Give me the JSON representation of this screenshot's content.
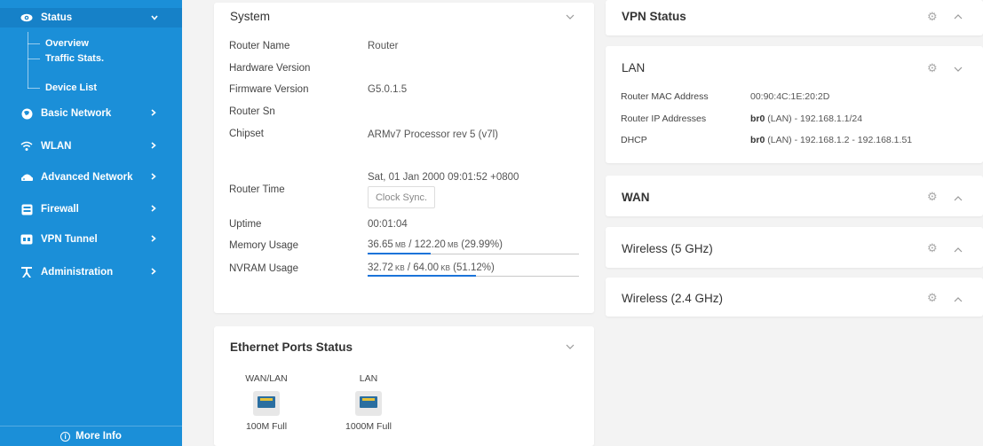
{
  "sidebar": {
    "items": [
      {
        "label": "Status",
        "icon": "eye-icon"
      },
      {
        "label": "Basic Network",
        "icon": "globe-icon"
      },
      {
        "label": "WLAN",
        "icon": "wifi-icon"
      },
      {
        "label": "Advanced Network",
        "icon": "router-icon"
      },
      {
        "label": "Firewall",
        "icon": "firewall-icon"
      },
      {
        "label": "VPN Tunnel",
        "icon": "vpn-icon"
      },
      {
        "label": "Administration",
        "icon": "admin-icon"
      }
    ],
    "sub_items": [
      "Overview",
      "Traffic Stats.",
      "Device List"
    ],
    "more_info": "More Info",
    "colors": {
      "background": "#1b8fd8"
    }
  },
  "system": {
    "title": "System",
    "router_name_label": "Router Name",
    "router_name": "Router",
    "hardware_version_label": "Hardware Version",
    "firmware_version_label": "Firmware Version",
    "firmware_version": "G5.0.1.5",
    "router_sn_label": "Router Sn",
    "chipset_label": "Chipset",
    "chipset": "ARMv7 Processor rev 5 (v7l)",
    "router_time_label": "Router Time",
    "router_time": "Sat, 01 Jan 2000 09:01:52 +0800",
    "clock_sync": "Clock Sync.",
    "uptime_label": "Uptime",
    "uptime": "00:01:04",
    "memory_label": "Memory Usage",
    "memory": {
      "used": "36.65",
      "total": "122.20",
      "unit": "MB",
      "percent": "(29.99%)",
      "fraction": 0.2999
    },
    "nvram_label": "NVRAM Usage",
    "nvram": {
      "used": "32.72",
      "total": "64.00",
      "unit": "KB",
      "percent": "(51.12%)",
      "fraction": 0.5112
    }
  },
  "ethernet": {
    "title": "Ethernet Ports Status",
    "ports": [
      {
        "name": "WAN/LAN",
        "status": "100M Full"
      },
      {
        "name": "LAN",
        "status": "1000M Full"
      }
    ]
  },
  "vpn": {
    "title": "VPN Status"
  },
  "lan": {
    "title": "LAN",
    "mac_label": "Router MAC Address",
    "mac": "00:90:4C:1E:20:2D",
    "ip_label": "Router IP Addresses",
    "ip_iface": "br0",
    "ip_value": " (LAN) - 192.168.1.1/24",
    "dhcp_label": "DHCP",
    "dhcp_iface": "br0",
    "dhcp_value": " (LAN) - 192.168.1.2 - 192.168.1.51"
  },
  "wan": {
    "title": "WAN"
  },
  "wireless5": {
    "title": "Wireless (5 GHz)"
  },
  "wireless24": {
    "title": "Wireless (2.4 GHz)"
  }
}
